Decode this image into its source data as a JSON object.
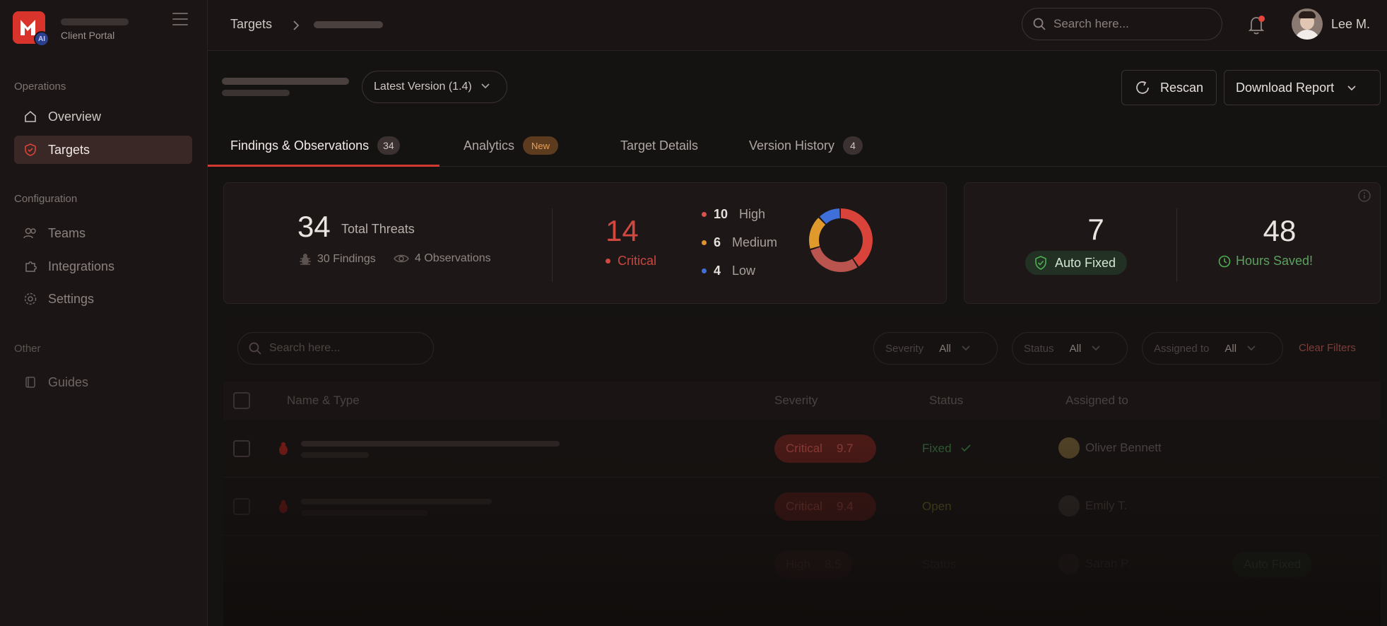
{
  "brand": {
    "subtitle": "Client Portal",
    "logo_badge": "AI"
  },
  "sidebar": {
    "sections": [
      {
        "title": "Operations"
      },
      {
        "title": "Configuration"
      },
      {
        "title": "Other"
      }
    ],
    "items": [
      {
        "label": "Overview",
        "icon": "home-icon"
      },
      {
        "label": "Targets",
        "icon": "target-shield-icon",
        "active": true
      },
      {
        "label": "Teams",
        "icon": "users-icon"
      },
      {
        "label": "Integrations",
        "icon": "puzzle-icon"
      },
      {
        "label": "Settings",
        "icon": "gear-icon"
      },
      {
        "label": "Guides",
        "icon": "book-icon"
      }
    ]
  },
  "topbar": {
    "breadcrumb_root": "Targets",
    "search_placeholder": "Search here...",
    "user_name": "Lee M."
  },
  "header": {
    "version_label": "Latest Version (1.4)",
    "rescan_label": "Rescan",
    "download_label": "Download Report"
  },
  "tabs": [
    {
      "label": "Findings & Observations",
      "badge": "34",
      "active": true
    },
    {
      "label": "Analytics",
      "badge": "New"
    },
    {
      "label": "Target Details"
    },
    {
      "label": "Version History",
      "badge": "4"
    }
  ],
  "summary": {
    "total": "34",
    "total_label": "Total Threats",
    "findings": "30 Findings",
    "observations": "4 Observations",
    "critical": "14",
    "critical_label": "Critical",
    "legend": [
      {
        "value": "10",
        "label": "High",
        "color": "#d9534a"
      },
      {
        "value": "6",
        "label": "Medium",
        "color": "#e0902e"
      },
      {
        "value": "4",
        "label": "Low",
        "color": "#3f6fd8"
      }
    ],
    "donut": [
      {
        "label": "Critical",
        "value": 14,
        "color": "#d9433a"
      },
      {
        "label": "High",
        "value": 10,
        "color": "#b9544e"
      },
      {
        "label": "Medium",
        "value": 6,
        "color": "#e09a2c"
      },
      {
        "label": "Low",
        "value": 4,
        "color": "#3f6fd8"
      }
    ],
    "auto_fixed": "7",
    "auto_fixed_label": "Auto Fixed",
    "hours_saved": "48",
    "hours_saved_label": "Hours Saved!"
  },
  "table": {
    "search_placeholder": "Search here...",
    "filters": [
      {
        "label": "Severity",
        "value": "All"
      },
      {
        "label": "Status",
        "value": "All"
      },
      {
        "label": "Assigned to",
        "value": "All"
      }
    ],
    "clear_filters": "Clear Filters",
    "columns": [
      "Name & Type",
      "Severity",
      "Status",
      "Assigned to"
    ],
    "rows": [
      {
        "severity": "Critical",
        "score": "9.7",
        "status": "Fixed",
        "assignee": "Oliver Bennett"
      },
      {
        "severity": "Critical",
        "score": "9.4",
        "status": "Open",
        "assignee": "Emily T."
      },
      {
        "severity": "High",
        "score": "8.5",
        "status": "Status",
        "assignee": "Sarah P.",
        "chip": "Auto Fixed"
      }
    ]
  },
  "colors": {
    "accent": "#d23a31",
    "background": "#151212",
    "success": "#5aa05f"
  }
}
